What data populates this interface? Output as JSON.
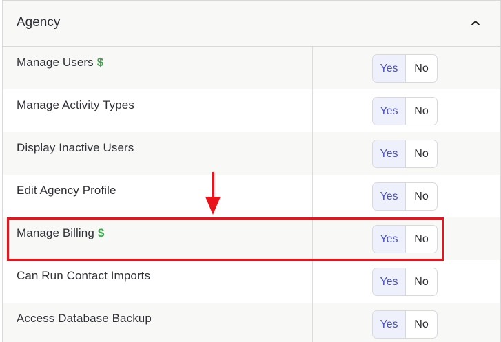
{
  "section": {
    "title": "Agency"
  },
  "toggle": {
    "yes_label": "Yes",
    "no_label": "No"
  },
  "rows": [
    {
      "label": "Manage Users",
      "dollar": "$"
    },
    {
      "label": "Manage Activity Types"
    },
    {
      "label": "Display Inactive Users"
    },
    {
      "label": "Edit Agency Profile"
    },
    {
      "label": "Manage Billing",
      "dollar": "$"
    },
    {
      "label": "Can Run Contact Imports"
    },
    {
      "label": "Access Database Backup"
    }
  ],
  "colors": {
    "annotation": "#e8131b",
    "dollar": "#3fa34d",
    "selected_yes_text": "#4750c8"
  },
  "icons": {
    "collapse": "chevron-up-icon",
    "annotation_arrow": "arrow-down-icon"
  }
}
